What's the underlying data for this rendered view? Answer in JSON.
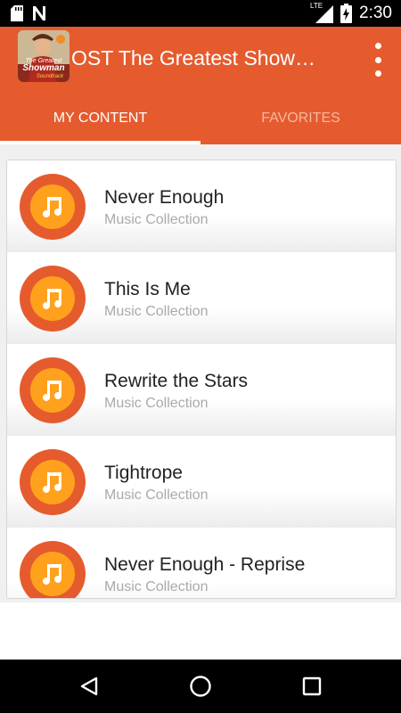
{
  "status_bar": {
    "time": "2:30",
    "network_label": "LTE",
    "icons": [
      "sd-card-icon",
      "n-notification-icon",
      "signal-icon",
      "battery-charging-icon"
    ]
  },
  "app_bar": {
    "title": "OST The Greatest Showman Soundtrack",
    "icon_text_line1": "The Greatest",
    "icon_text_line2": "Showman",
    "icon_text_line3": "Soundtrack",
    "color": "#E55B2E"
  },
  "tabs": [
    {
      "label": "MY CONTENT",
      "active": true
    },
    {
      "label": "FAVORITES",
      "active": false
    }
  ],
  "list": {
    "items": [
      {
        "title": "Never Enough",
        "subtitle": "Music Collection"
      },
      {
        "title": "This Is Me",
        "subtitle": "Music Collection"
      },
      {
        "title": "Rewrite the Stars",
        "subtitle": "Music Collection"
      },
      {
        "title": "Tightrope",
        "subtitle": "Music Collection"
      },
      {
        "title": "Never Enough - Reprise",
        "subtitle": "Music Collection"
      }
    ],
    "icon": "music-note-icon",
    "accent_outer": "#E55B2E",
    "accent_inner": "#FFA11C"
  },
  "nav_bar": {
    "buttons": [
      "back-icon",
      "home-icon",
      "recents-icon"
    ]
  }
}
